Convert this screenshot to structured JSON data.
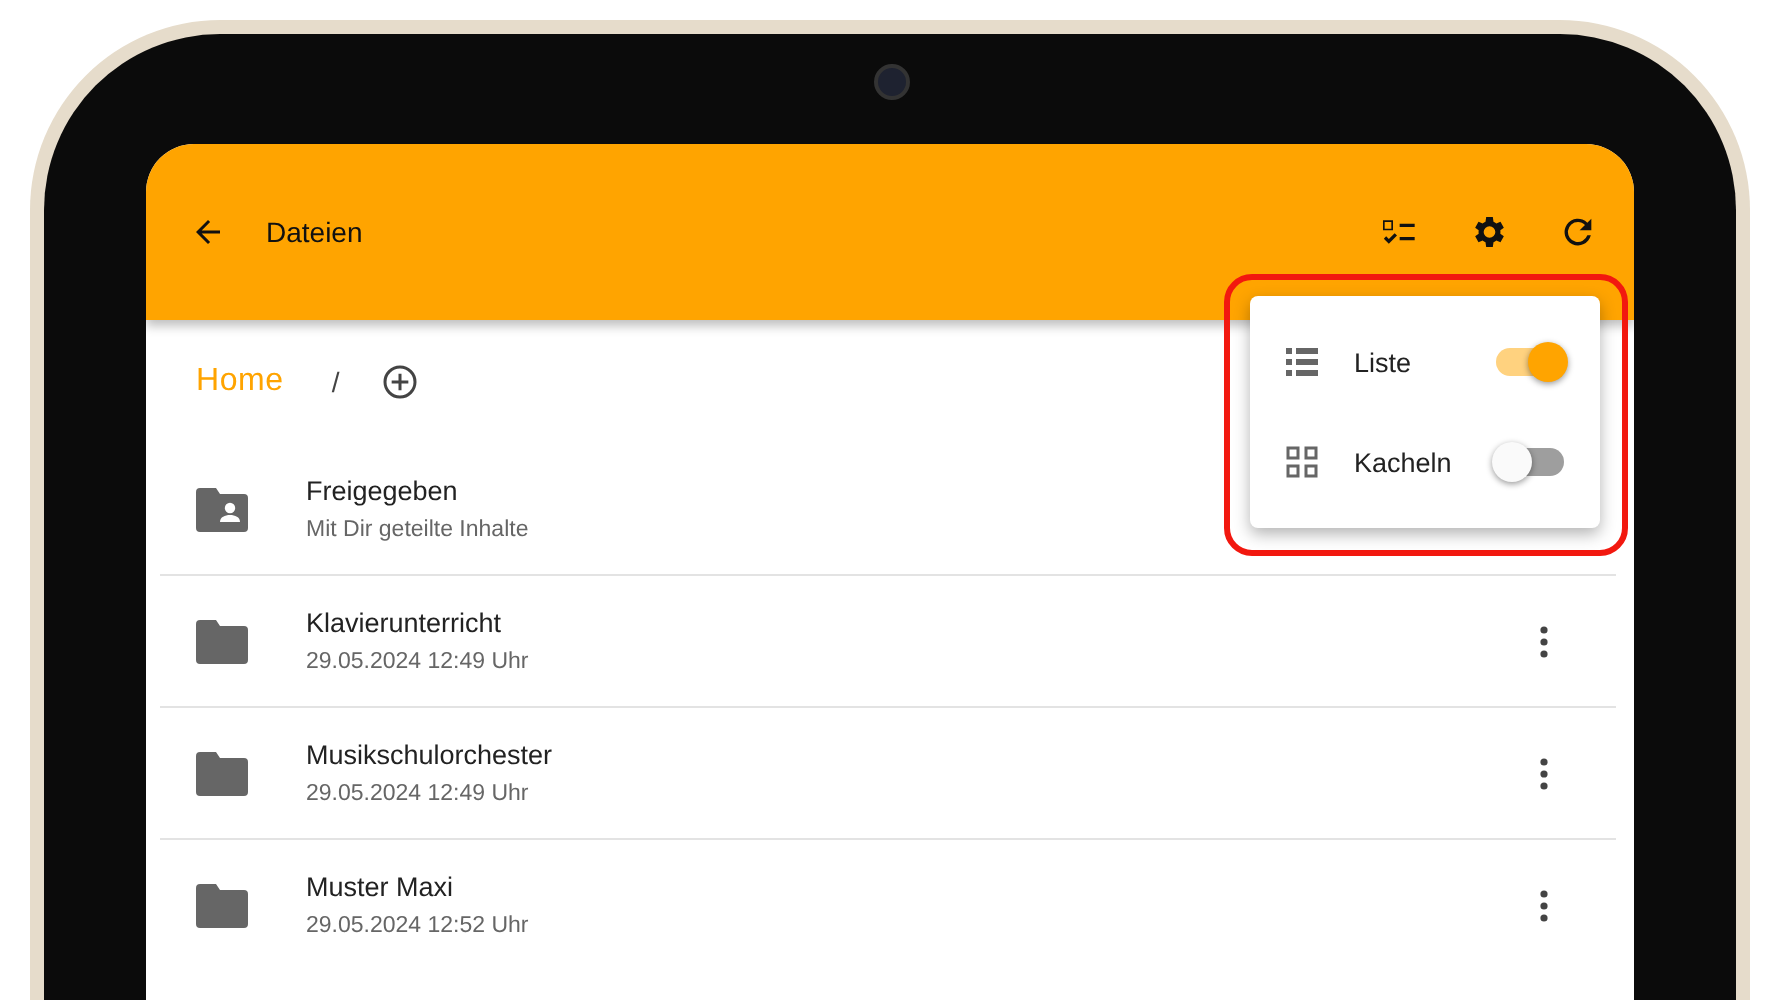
{
  "app_bar": {
    "title": "Dateien"
  },
  "breadcrumb": {
    "home": "Home",
    "separator": "/"
  },
  "files": [
    {
      "kind": "shared",
      "name": "Freigegeben",
      "subtitle": "Mit Dir geteilte Inhalte"
    },
    {
      "kind": "folder",
      "name": "Klavierunterricht",
      "subtitle": "29.05.2024 12:49 Uhr"
    },
    {
      "kind": "folder",
      "name": "Musikschulorchester",
      "subtitle": "29.05.2024 12:49 Uhr"
    },
    {
      "kind": "folder",
      "name": "Muster Maxi",
      "subtitle": "29.05.2024 12:52 Uhr"
    }
  ],
  "view_menu": {
    "items": [
      {
        "label": "Liste",
        "on": true
      },
      {
        "label": "Kacheln",
        "on": false
      }
    ]
  }
}
